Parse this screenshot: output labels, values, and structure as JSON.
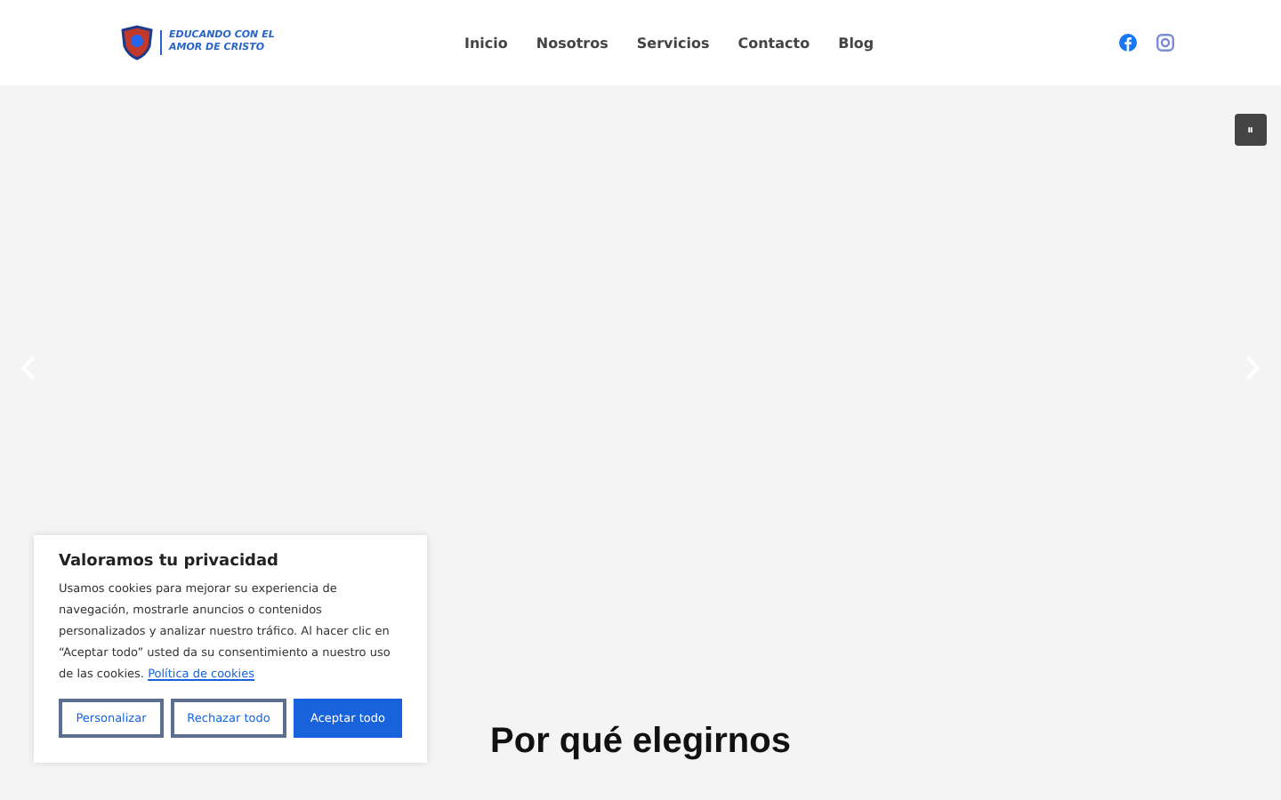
{
  "logo": {
    "lines": [
      "EDUCANDO CON EL",
      "AMOR DE CRISTO"
    ]
  },
  "nav": [
    {
      "label": "Inicio"
    },
    {
      "label": "Nosotros"
    },
    {
      "label": "Servicios"
    },
    {
      "label": "Contacto"
    },
    {
      "label": "Blog"
    }
  ],
  "social": [
    {
      "kind": "facebook"
    },
    {
      "kind": "instagram"
    }
  ],
  "slider": {
    "pause": "⏸"
  },
  "section": {
    "heading": "Por qué elegirnos"
  },
  "cookie": {
    "title": "Valoramos tu privacidad",
    "text": "Usamos cookies para mejorar su experiencia de navegación, mostrarle anuncios o contenidos personalizados y analizar nuestro tráfico. Al hacer clic en “Aceptar todo” usted da su consentimiento a nuestro uso de las cookies.",
    "link": "Política de cookies",
    "buttons": [
      {
        "label": "Personalizar",
        "kind": "outline"
      },
      {
        "label": "Rechazar todo",
        "kind": "outline"
      },
      {
        "label": "Aceptar todo",
        "kind": "primary"
      }
    ]
  }
}
